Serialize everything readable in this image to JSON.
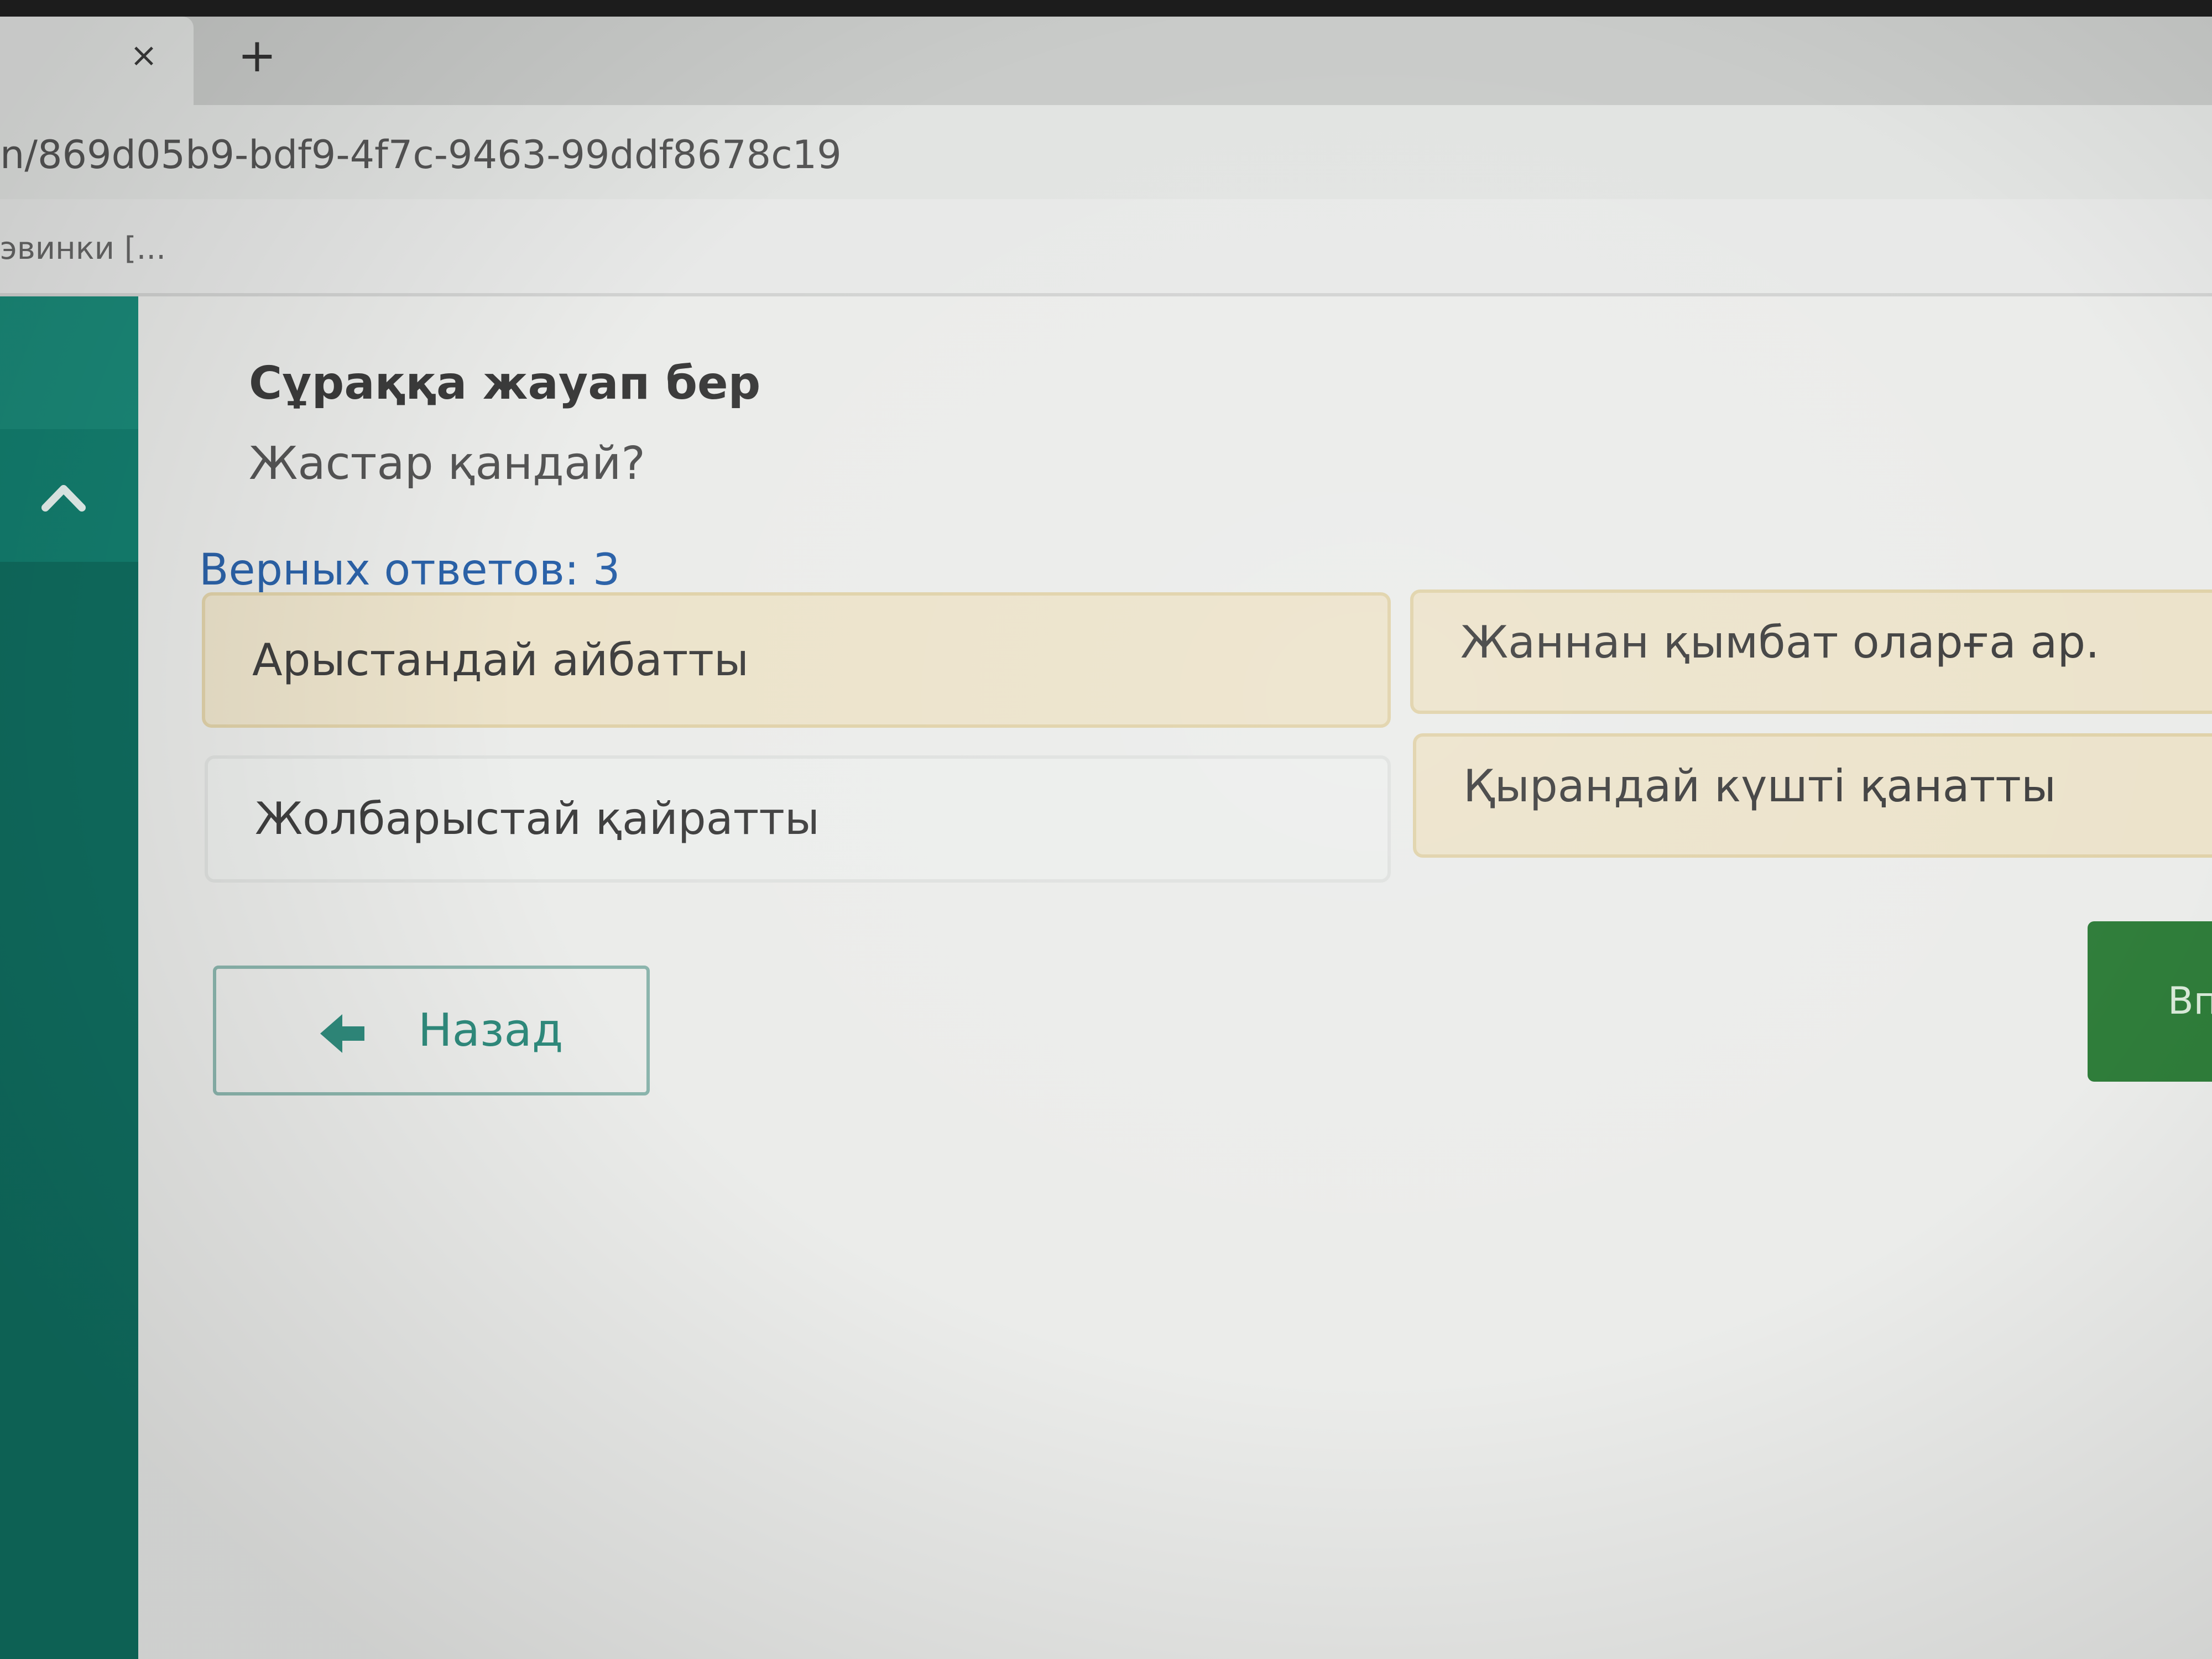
{
  "browser": {
    "tab_close_glyph": "×",
    "new_tab_glyph": "+",
    "url": "n/869d05b9-bdf9-4f7c-9463-99ddf8678c19",
    "bookmark": "эвинки [..."
  },
  "quiz": {
    "title": "Сұраққа жауап бер",
    "question": "Жастар қандай?",
    "correct_count_label": "Верных ответов: 3",
    "options": [
      {
        "label": "Арыстандай айбатты",
        "selected": true
      },
      {
        "label": "Жаннан қымбат оларға ар.",
        "selected": true
      },
      {
        "label": "Жолбарыстай қайратты",
        "selected": false
      },
      {
        "label": "Қырандай күшті қанатты",
        "selected": true
      }
    ],
    "back_label": "Назад",
    "next_label": "Вп"
  },
  "colors": {
    "sidebar": "#0f6e60",
    "selected_option": "#ece3cb",
    "accent_teal": "#2f8a7c",
    "count_blue": "#2b62a8",
    "next_green": "#2f7d3a"
  },
  "icons": {
    "sidebar_collapse": "chevron-up-icon",
    "back": "arrow-left-icon"
  }
}
